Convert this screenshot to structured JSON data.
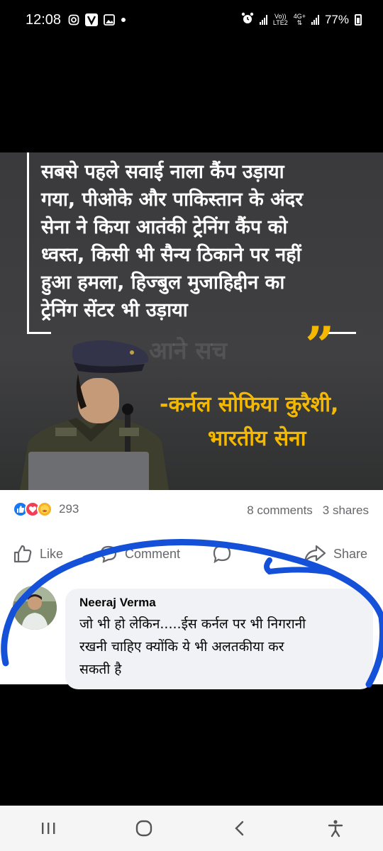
{
  "status_bar": {
    "time": "12:08",
    "network_type": "4G+",
    "volte_top": "Vo))",
    "volte_bottom": "LTE2",
    "battery": "77%"
  },
  "news_image": {
    "quote_lines": [
      "सबसे पहले सवाई नाला कैंप उड़ाया",
      "गया, पीओके और पाकिस्तान के अंदर",
      "सेना ने किया आतंकी ट्रेनिंग कैंप को",
      "ध्वस्त, किसी भी सैन्य ठिकाने पर नहीं",
      "हुआ हमला, हिज्बुल मुजाहिद्दीन का",
      "ट्रेनिंग सेंटर भी उड़ाया"
    ],
    "quote_mark": "”",
    "watermark": "आने सच",
    "attribution_line1": "-कर्नल सोफिया कुरैशी,",
    "attribution_line2": "भारतीय सेना"
  },
  "post": {
    "reaction_count": "293",
    "comments": "8 comments",
    "shares": "3 shares",
    "actions": {
      "like": "Like",
      "comment": "Comment",
      "share": "Share"
    }
  },
  "comment": {
    "author": "Neeraj Verma",
    "lines": [
      "जो भी हो लेकिन.....ईस कर्नल पर भी निगरानी",
      "रखनी चाहिए क्योंकि ये भी अलतकीया कर",
      "सकती है"
    ]
  },
  "colors": {
    "highlight_scribble": "#1550d8",
    "quote_yellow": "#f5b800",
    "facebook_blue": "#1877f2"
  }
}
